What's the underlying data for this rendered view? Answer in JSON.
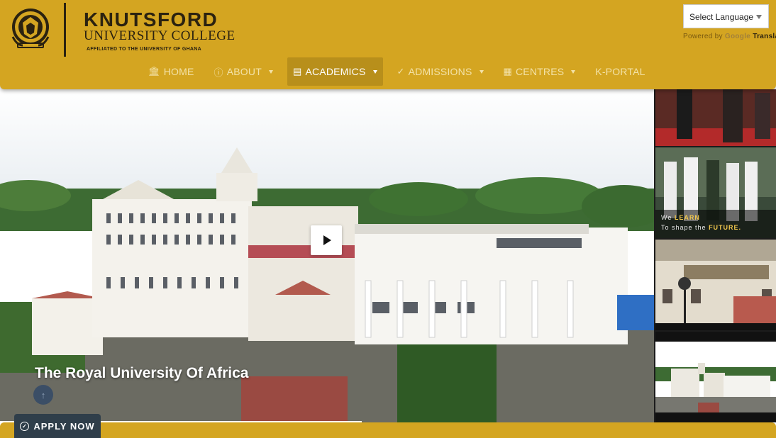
{
  "header": {
    "brand_name": "KNUTSFORD",
    "brand_sub": "UNIVERSITY COLLEGE",
    "brand_affiliation": "AFFILIATED TO THE UNIVERSITY OF GHANA"
  },
  "translate": {
    "select_label": "Select Language",
    "powered_by": "Powered by",
    "google": "Google",
    "translate": "Translate"
  },
  "nav": {
    "items": [
      {
        "label": "HOME",
        "icon": "institution-icon",
        "dropdown": false,
        "active": false
      },
      {
        "label": "ABOUT",
        "icon": "info-circle-icon",
        "dropdown": true,
        "active": false
      },
      {
        "label": "ACADEMICS",
        "icon": "book-icon",
        "dropdown": true,
        "active": true
      },
      {
        "label": "ADMISSIONS",
        "icon": "check-circle-icon",
        "dropdown": true,
        "active": false
      },
      {
        "label": "CENTRES",
        "icon": "building-icon",
        "dropdown": true,
        "active": false
      },
      {
        "label": "K-PORTAL",
        "icon": "",
        "dropdown": false,
        "active": false
      }
    ]
  },
  "hero": {
    "title": "The Royal University Of Africa"
  },
  "thumbnails": {
    "caption_line1_prefix": "We",
    "caption_line1_highlight": "LEARN",
    "caption_line2_prefix": "To shape the",
    "caption_line2_highlight": "FUTURE."
  },
  "apply": {
    "label": "APPLY NOW"
  },
  "colors": {
    "brand_gold": "#d4a521",
    "active_nav": "#b88f1b",
    "dark_text": "#2b2210",
    "apply_button": "#2f3e4a"
  }
}
